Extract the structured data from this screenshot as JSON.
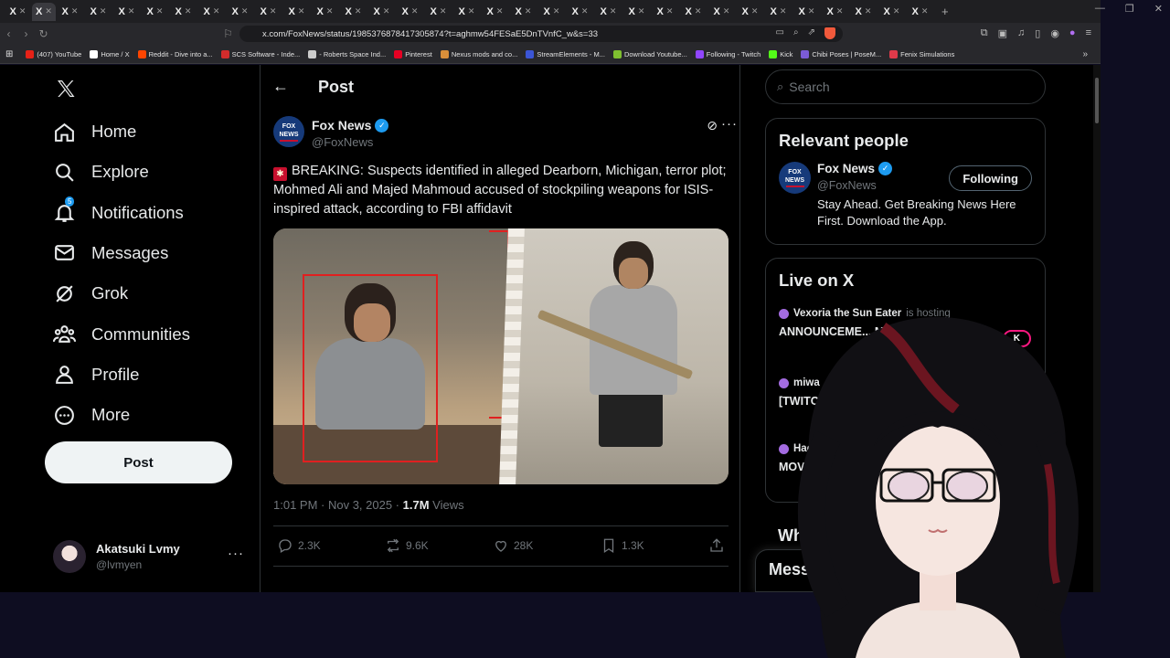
{
  "browser": {
    "tab_count": 33,
    "url": "x.com/FoxNews/status/1985376878417305874?t=aghmw54FESaE5DnTVnfC_w&s=33",
    "bookmarks": [
      {
        "label": "(407) YouTube",
        "color": "#e62117"
      },
      {
        "label": "Home / X",
        "color": "#ffffff"
      },
      {
        "label": "Reddit - Dive into a...",
        "color": "#ff4500"
      },
      {
        "label": "SCS Software - Inde...",
        "color": "#d22c2c"
      },
      {
        "label": "- Roberts Space Ind...",
        "color": "#cccccc"
      },
      {
        "label": "Pinterest",
        "color": "#e60023"
      },
      {
        "label": "Nexus mods and co...",
        "color": "#d98f3a"
      },
      {
        "label": "StreamElements - M...",
        "color": "#3b55d6"
      },
      {
        "label": "Download Youtube...",
        "color": "#7fbf30"
      },
      {
        "label": "Following - Twitch",
        "color": "#9146ff"
      },
      {
        "label": "Kick",
        "color": "#53fc18"
      },
      {
        "label": "Chibi Poses | PoseM...",
        "color": "#7b5bd6"
      },
      {
        "label": "Fenix Simulations",
        "color": "#e03a4a"
      }
    ]
  },
  "sidebar": {
    "items": [
      {
        "label": "Home",
        "icon": "home-icon"
      },
      {
        "label": "Explore",
        "icon": "search-icon"
      },
      {
        "label": "Notifications",
        "icon": "bell-icon",
        "badge": "5"
      },
      {
        "label": "Messages",
        "icon": "envelope-icon"
      },
      {
        "label": "Grok",
        "icon": "grok-icon"
      },
      {
        "label": "Communities",
        "icon": "people-icon"
      },
      {
        "label": "Profile",
        "icon": "person-icon"
      },
      {
        "label": "More",
        "icon": "more-circle-icon"
      }
    ],
    "post_button": "Post",
    "account": {
      "name": "Akatsuki Lvmy",
      "handle": "@lvmyen"
    }
  },
  "main": {
    "title": "Post",
    "author": {
      "name": "Fox News",
      "handle": "@FoxNews",
      "logo_text": "FOX NEWS"
    },
    "text": "BREAKING: Suspects identified in alleged Dearborn, Michigan, terror plot; Mohmed Ali and Majed Mahmoud accused of stockpiling weapons for ISIS-inspired attack, according to FBI affidavit",
    "timestamp": "1:01 PM · Nov 3, 2025 · ",
    "views_count": "1.7M",
    "views_label": " Views",
    "stats": {
      "replies": "2.3K",
      "reposts": "9.6K",
      "likes": "28K",
      "bookmarks": "1.3K"
    }
  },
  "right": {
    "search_placeholder": "Search",
    "relevant_title": "Relevant people",
    "person": {
      "name": "Fox News",
      "handle": "@FoxNews",
      "bio": "Stay Ahead. Get Breaking News Here First. Download the App.",
      "button": "Following"
    },
    "live_title": "Live on X",
    "live": [
      {
        "host": "Vexoria the Sun Eater",
        "suffix": "is hosting",
        "title": "ANNOUNCEME... MONSTER LOVE...",
        "pill": "K"
      },
      {
        "host": "miwa",
        "suffix": "",
        "title": "[TWITCH+...",
        "pill": ""
      },
      {
        "host": "Hades",
        "suffix": "",
        "title": "MOVEME...",
        "pill": ""
      }
    ],
    "wh_title": "Wh...",
    "messages_label": "Mess..."
  }
}
